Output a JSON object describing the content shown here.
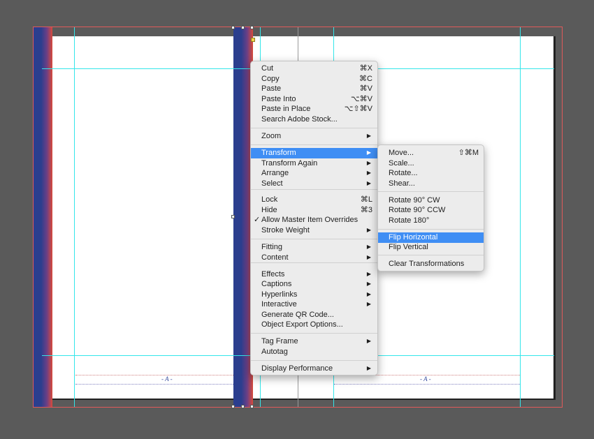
{
  "context_menu": {
    "items": [
      {
        "label": "Cut",
        "shortcut": "⌘X"
      },
      {
        "label": "Copy",
        "shortcut": "⌘C"
      },
      {
        "label": "Paste",
        "shortcut": "⌘V"
      },
      {
        "label": "Paste Into",
        "shortcut": "⌥⌘V"
      },
      {
        "label": "Paste in Place",
        "shortcut": "⌥⇧⌘V"
      },
      {
        "label": "Search Adobe Stock...",
        "shortcut": ""
      },
      {
        "label": "Zoom",
        "submenu": true
      },
      {
        "label": "Transform",
        "submenu": true,
        "highlighted": true
      },
      {
        "label": "Transform Again",
        "submenu": true
      },
      {
        "label": "Arrange",
        "submenu": true
      },
      {
        "label": "Select",
        "submenu": true
      },
      {
        "label": "Lock",
        "shortcut": "⌘L"
      },
      {
        "label": "Hide",
        "shortcut": "⌘3"
      },
      {
        "label": "Allow Master Item Overrides",
        "checked": true
      },
      {
        "label": "Stroke Weight",
        "submenu": true
      },
      {
        "label": "Fitting",
        "submenu": true
      },
      {
        "label": "Content",
        "submenu": true
      },
      {
        "label": "Effects",
        "submenu": true
      },
      {
        "label": "Captions",
        "submenu": true
      },
      {
        "label": "Hyperlinks",
        "submenu": true
      },
      {
        "label": "Interactive",
        "submenu": true
      },
      {
        "label": "Generate QR Code...",
        "shortcut": ""
      },
      {
        "label": "Object Export Options...",
        "shortcut": ""
      },
      {
        "label": "Tag Frame",
        "submenu": true
      },
      {
        "label": "Autotag",
        "shortcut": ""
      },
      {
        "label": "Display Performance",
        "submenu": true
      }
    ],
    "check_glyph": "✓",
    "arrow_glyph": "▶"
  },
  "transform_submenu": {
    "items": [
      {
        "label": "Move...",
        "shortcut": "⇧⌘M"
      },
      {
        "label": "Scale...",
        "shortcut": ""
      },
      {
        "label": "Rotate...",
        "shortcut": ""
      },
      {
        "label": "Shear...",
        "shortcut": ""
      },
      {
        "label": "Rotate 90° CW",
        "shortcut": ""
      },
      {
        "label": "Rotate 90° CCW",
        "shortcut": ""
      },
      {
        "label": "Rotate 180°",
        "shortcut": ""
      },
      {
        "label": "Flip Horizontal",
        "shortcut": "",
        "highlighted": true
      },
      {
        "label": "Flip Vertical",
        "shortcut": ""
      },
      {
        "label": "Clear Transformations",
        "shortcut": ""
      }
    ]
  },
  "page_footer": {
    "left_page_marker": "- A -",
    "right_page_marker": "- A -"
  },
  "colors": {
    "pasteboard": "#5a5a5a",
    "guide": "#33e6ea",
    "bleed": "#e05a5a",
    "highlight": "#3f8ef4",
    "bar_blue": "#2b3e8e",
    "bar_red": "#d94a3a"
  }
}
